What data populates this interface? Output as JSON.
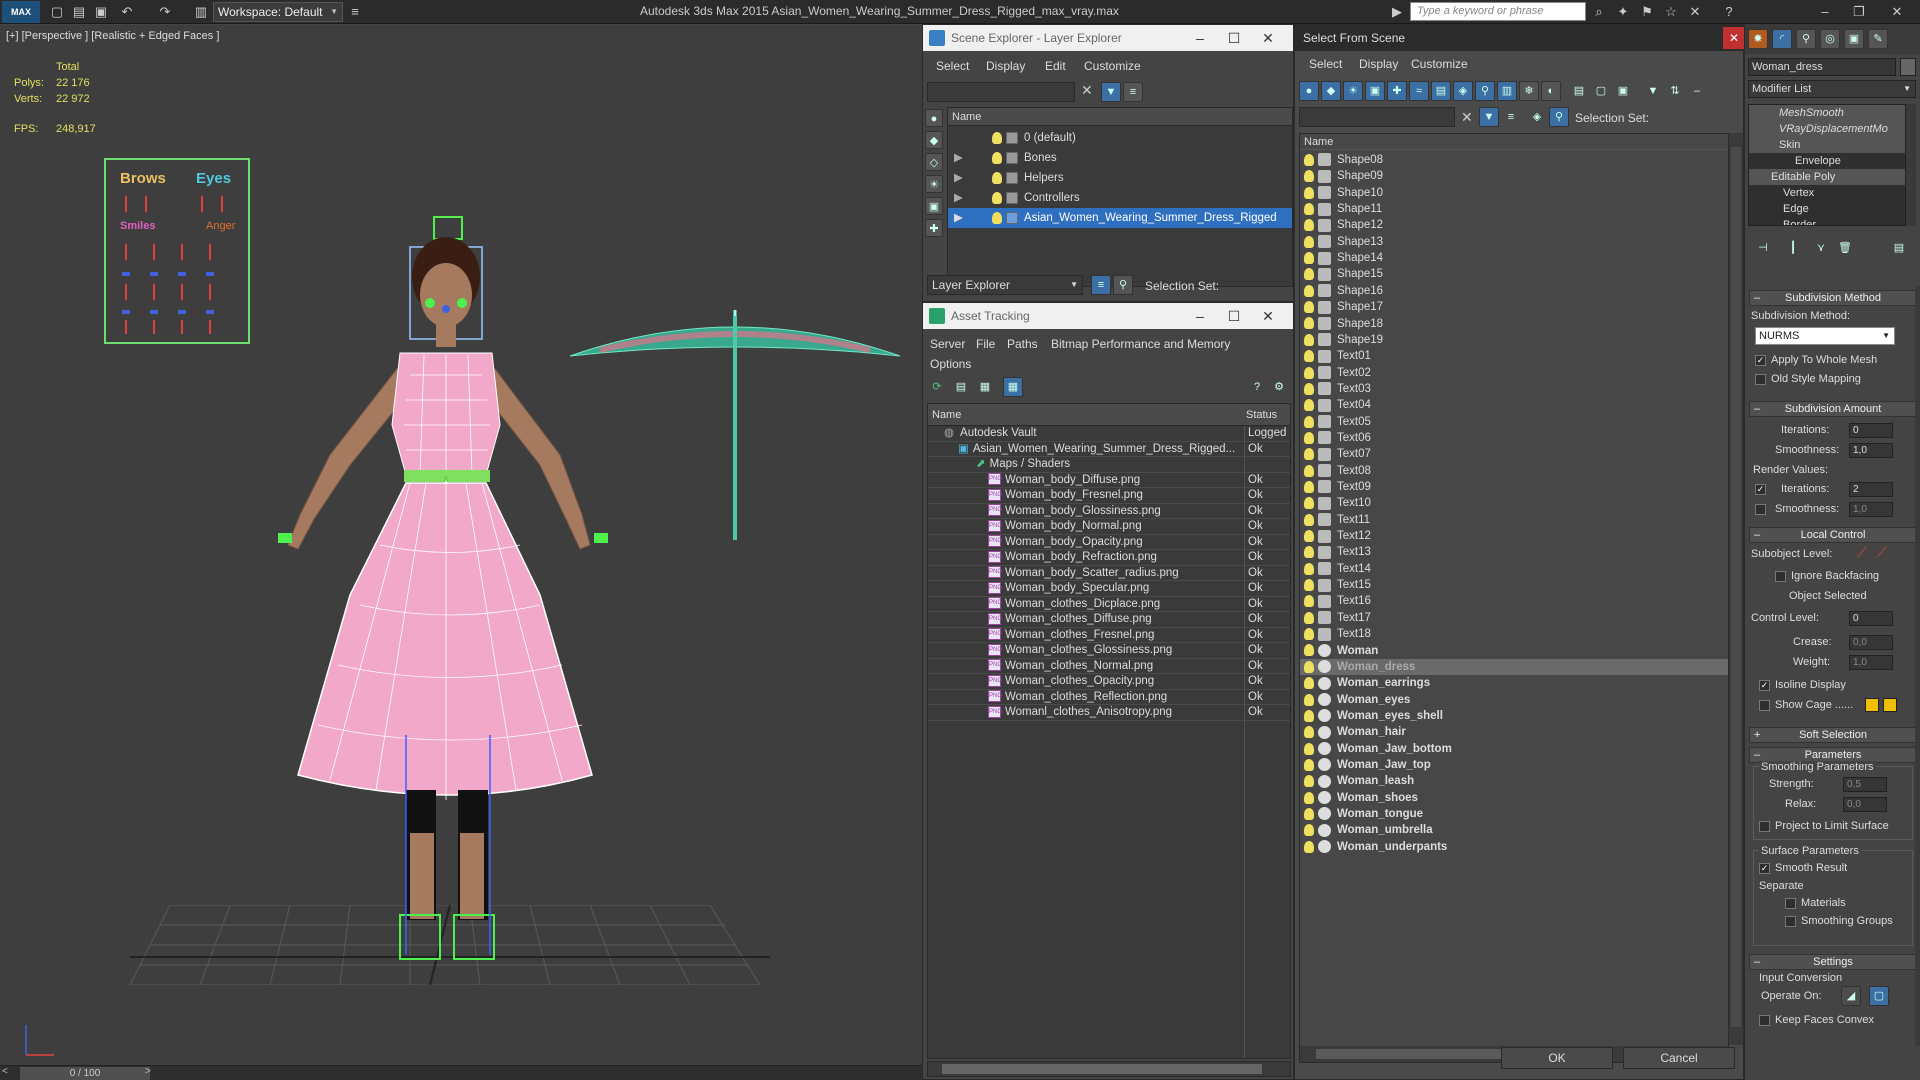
{
  "titlebar": {
    "logo": "MAX",
    "workspace": "Workspace: Default",
    "app_title": "Autodesk 3ds Max  2015     Asian_Women_Wearing_Summer_Dress_Rigged_max_vray.max",
    "keyword_placeholder": "Type a keyword or phrase"
  },
  "viewport": {
    "label": "[+] [Perspective ] [Realistic + Edged Faces ]",
    "total_label": "Total",
    "polys_label": "Polys:",
    "polys_value": "22 176",
    "verts_label": "Verts:",
    "verts_value": "22 972",
    "fps_label": "FPS:",
    "fps_value": "248,917",
    "face_panel": {
      "brows": "Brows",
      "eyes": "Eyes",
      "smiles": "Smiles",
      "anger": "Anger"
    },
    "timeline": "0 / 100"
  },
  "scene_explorer": {
    "title": "Scene Explorer - Layer Explorer",
    "menu": [
      "Select",
      "Display",
      "Edit",
      "Customize"
    ],
    "column": "Name",
    "layers": [
      "0 (default)",
      "Bones",
      "Helpers",
      "Controllers",
      "Asian_Women_Wearing_Summer_Dress_Rigged"
    ],
    "footer_dropdown": "Layer Explorer",
    "selection_set": "Selection Set:"
  },
  "asset_tracking": {
    "title": "Asset Tracking",
    "menu": [
      "Server",
      "File",
      "Paths",
      "Bitmap Performance and Memory",
      "Options"
    ],
    "col_name": "Name",
    "col_status": "Status",
    "rows": [
      {
        "name": "Autodesk Vault",
        "status": "Logged"
      },
      {
        "name": "Asian_Women_Wearing_Summer_Dress_Rigged...",
        "status": "Ok"
      },
      {
        "name": "Maps / Shaders",
        "status": ""
      },
      {
        "name": "Woman_body_Diffuse.png",
        "status": "Ok"
      },
      {
        "name": "Woman_body_Fresnel.png",
        "status": "Ok"
      },
      {
        "name": "Woman_body_Glossiness.png",
        "status": "Ok"
      },
      {
        "name": "Woman_body_Normal.png",
        "status": "Ok"
      },
      {
        "name": "Woman_body_Opacity.png",
        "status": "Ok"
      },
      {
        "name": "Woman_body_Refraction.png",
        "status": "Ok"
      },
      {
        "name": "Woman_body_Scatter_radius.png",
        "status": "Ok"
      },
      {
        "name": "Woman_body_Specular.png",
        "status": "Ok"
      },
      {
        "name": "Woman_clothes_Dicplace.png",
        "status": "Ok"
      },
      {
        "name": "Woman_clothes_Diffuse.png",
        "status": "Ok"
      },
      {
        "name": "Woman_clothes_Fresnel.png",
        "status": "Ok"
      },
      {
        "name": "Woman_clothes_Glossiness.png",
        "status": "Ok"
      },
      {
        "name": "Woman_clothes_Normal.png",
        "status": "Ok"
      },
      {
        "name": "Woman_clothes_Opacity.png",
        "status": "Ok"
      },
      {
        "name": "Woman_clothes_Reflection.png",
        "status": "Ok"
      },
      {
        "name": "Womanl_clothes_Anisotropy.png",
        "status": "Ok"
      }
    ]
  },
  "select_from_scene": {
    "title": "Select From Scene",
    "menu": [
      "Select",
      "Display",
      "Customize"
    ],
    "selection_set": "Selection Set:",
    "column": "Name",
    "shapes": [
      "Shape08",
      "Shape09",
      "Shape10",
      "Shape11",
      "Shape12",
      "Shape13",
      "Shape14",
      "Shape15",
      "Shape16",
      "Shape17",
      "Shape18",
      "Shape19",
      "Text01",
      "Text02",
      "Text03",
      "Text04",
      "Text05",
      "Text06",
      "Text07",
      "Text08",
      "Text09",
      "Text10",
      "Text11",
      "Text12",
      "Text13",
      "Text14",
      "Text15",
      "Text16",
      "Text17",
      "Text18"
    ],
    "objects": [
      "Woman",
      "Woman_dress",
      "Woman_earrings",
      "Woman_eyes",
      "Woman_eyes_shell",
      "Woman_hair",
      "Woman_Jaw_bottom",
      "Woman_Jaw_top",
      "Woman_leash",
      "Woman_shoes",
      "Woman_tongue",
      "Woman_umbrella",
      "Woman_underpants"
    ],
    "selected": "Woman_dress",
    "ok": "OK",
    "cancel": "Cancel"
  },
  "modify_panel": {
    "object_name": "Woman_dress",
    "modifier_list": "Modifier List",
    "stack": [
      "MeshSmooth",
      "VRayDisplacementMo",
      "Skin",
      "Envelope",
      "Editable Poly",
      "Vertex",
      "Edge",
      "Border"
    ],
    "subdivision_method_title": "Subdivision Method",
    "subdivision_method_label": "Subdivision Method:",
    "subdivision_method_value": "NURMS",
    "apply_whole_mesh": "Apply To Whole Mesh",
    "old_style_mapping": "Old Style Mapping",
    "subdivision_amount_title": "Subdivision Amount",
    "iterations_label": "Iterations:",
    "iterations_value": "0",
    "smoothness_label": "Smoothness:",
    "smoothness_value": "1,0",
    "render_values": "Render Values:",
    "render_iterations_value": "2",
    "render_smoothness_value": "1,0",
    "local_control_title": "Local Control",
    "subobject_level": "Subobject Level:",
    "ignore_backfacing": "Ignore Backfacing",
    "object_selected": "Object Selected",
    "control_level_label": "Control Level:",
    "control_level_value": "0",
    "crease_label": "Crease:",
    "crease_value": "0,0",
    "weight_label": "Weight:",
    "weight_value": "1,0",
    "isoline_display": "Isoline Display",
    "show_cage": "Show Cage ......",
    "soft_selection_title": "Soft Selection",
    "parameters_title": "Parameters",
    "smoothing_parameters": "Smoothing Parameters",
    "strength_label": "Strength:",
    "strength_value": "0,5",
    "relax_label": "Relax:",
    "relax_value": "0,0",
    "project_limit": "Project to Limit Surface",
    "surface_parameters": "Surface Parameters",
    "smooth_result": "Smooth Result",
    "separate": "Separate",
    "materials": "Materials",
    "smoothing_groups": "Smoothing Groups",
    "settings_title": "Settings",
    "input_conversion": "Input Conversion",
    "operate_on": "Operate On:",
    "keep_faces_convex": "Keep Faces Convex"
  }
}
